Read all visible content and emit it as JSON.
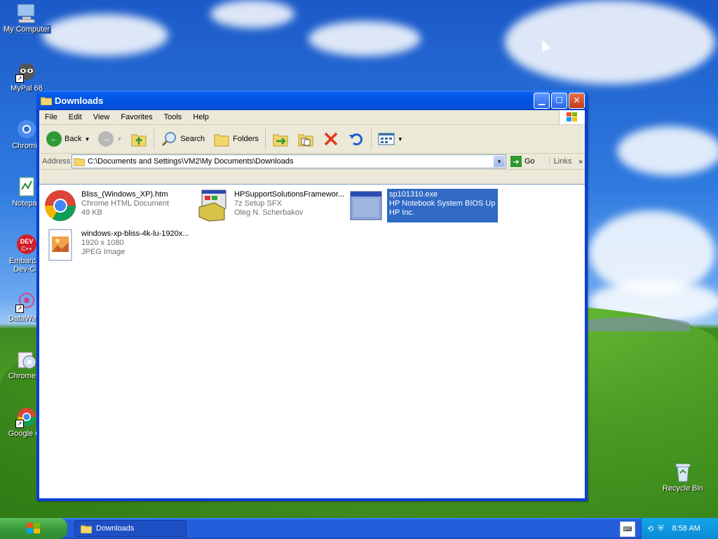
{
  "desktop": {
    "icons": [
      {
        "label": "My Computer"
      },
      {
        "label": "MyPal 68"
      },
      {
        "label": "Chromiu"
      },
      {
        "label": "Notepad"
      },
      {
        "label": "Embarcad Dev-C+"
      },
      {
        "label": "DataWago"
      },
      {
        "label": "ChromeSe"
      },
      {
        "label": "Google Ch"
      },
      {
        "label": "Recycle Bin"
      }
    ]
  },
  "window": {
    "title": "Downloads",
    "menu": [
      "File",
      "Edit",
      "View",
      "Favorites",
      "Tools",
      "Help"
    ],
    "toolbar": {
      "back": "Back",
      "search": "Search",
      "folders": "Folders"
    },
    "address": {
      "label": "Address",
      "value": "C:\\Documents and Settings\\VM2\\My Documents\\Downloads",
      "go": "Go",
      "links": "Links"
    },
    "files": [
      {
        "name": "Bliss_(Windows_XP).htm",
        "type": "Chrome HTML Document",
        "detail": "49 KB",
        "icon": "chrome-icon"
      },
      {
        "name": "HPSupportSolutionsFramewor...",
        "type": "7z Setup SFX",
        "detail": "Oleg N. Scherbakov",
        "icon": "installer-icon"
      },
      {
        "name": "sp101310.exe",
        "type": "HP Notebook System BIOS Up...",
        "detail": "HP Inc.",
        "icon": "exe-window-icon",
        "selected": true
      },
      {
        "name": "windows-xp-bliss-4k-lu-1920x...",
        "type": "1920 x 1080",
        "detail": "JPEG Image",
        "icon": "jpeg-image-icon"
      }
    ]
  },
  "taskbar": {
    "task": "Downloads",
    "time": "8:58 AM"
  }
}
